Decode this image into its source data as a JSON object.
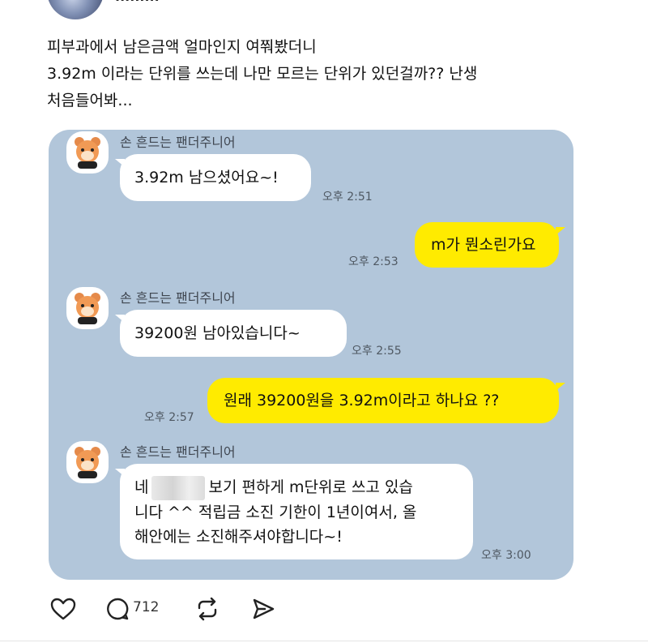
{
  "post": {
    "author": "·········",
    "lines": [
      "피부과에서 남은금액 얼마인지 여쭤봤더니",
      "3.92m 이라는 단위를 쓰는데 나만 모르는 단위가 있던걸까?? 난생",
      "처음들어봐..."
    ]
  },
  "chat": {
    "sender_name": "손 흔드는 팬더주니어",
    "messages": [
      {
        "from": "other",
        "text": "3.92m 남으셨어요~!",
        "time": "오후 2:51"
      },
      {
        "from": "me",
        "text": "m가 뭔소린가요",
        "time": "오후 2:53"
      },
      {
        "from": "other",
        "text": "39200원 남아있습니다~",
        "time": "오후 2:55"
      },
      {
        "from": "me",
        "text": "원래 39200원을 3.92m이라고 하나요 ??",
        "time": "오후 2:57"
      },
      {
        "from": "other",
        "time": "오후 3:00",
        "line1_prefix": "네",
        "line1_suffix": "보기 편하게 m단위로 쓰고 있습",
        "line2": "니다 ^^ 적립금 소진 기한이 1년이여서, 올",
        "line3": "해안에는 소진해주셔야합니다~!"
      }
    ]
  },
  "actions": {
    "like_icon": "heart-icon",
    "comment_icon": "comment-icon",
    "comment_count": "712",
    "repost_icon": "repost-icon",
    "share_icon": "send-icon"
  },
  "colors": {
    "chat_background": "#b2c6da",
    "my_bubble": "#ffeb00",
    "other_bubble": "#ffffff"
  }
}
